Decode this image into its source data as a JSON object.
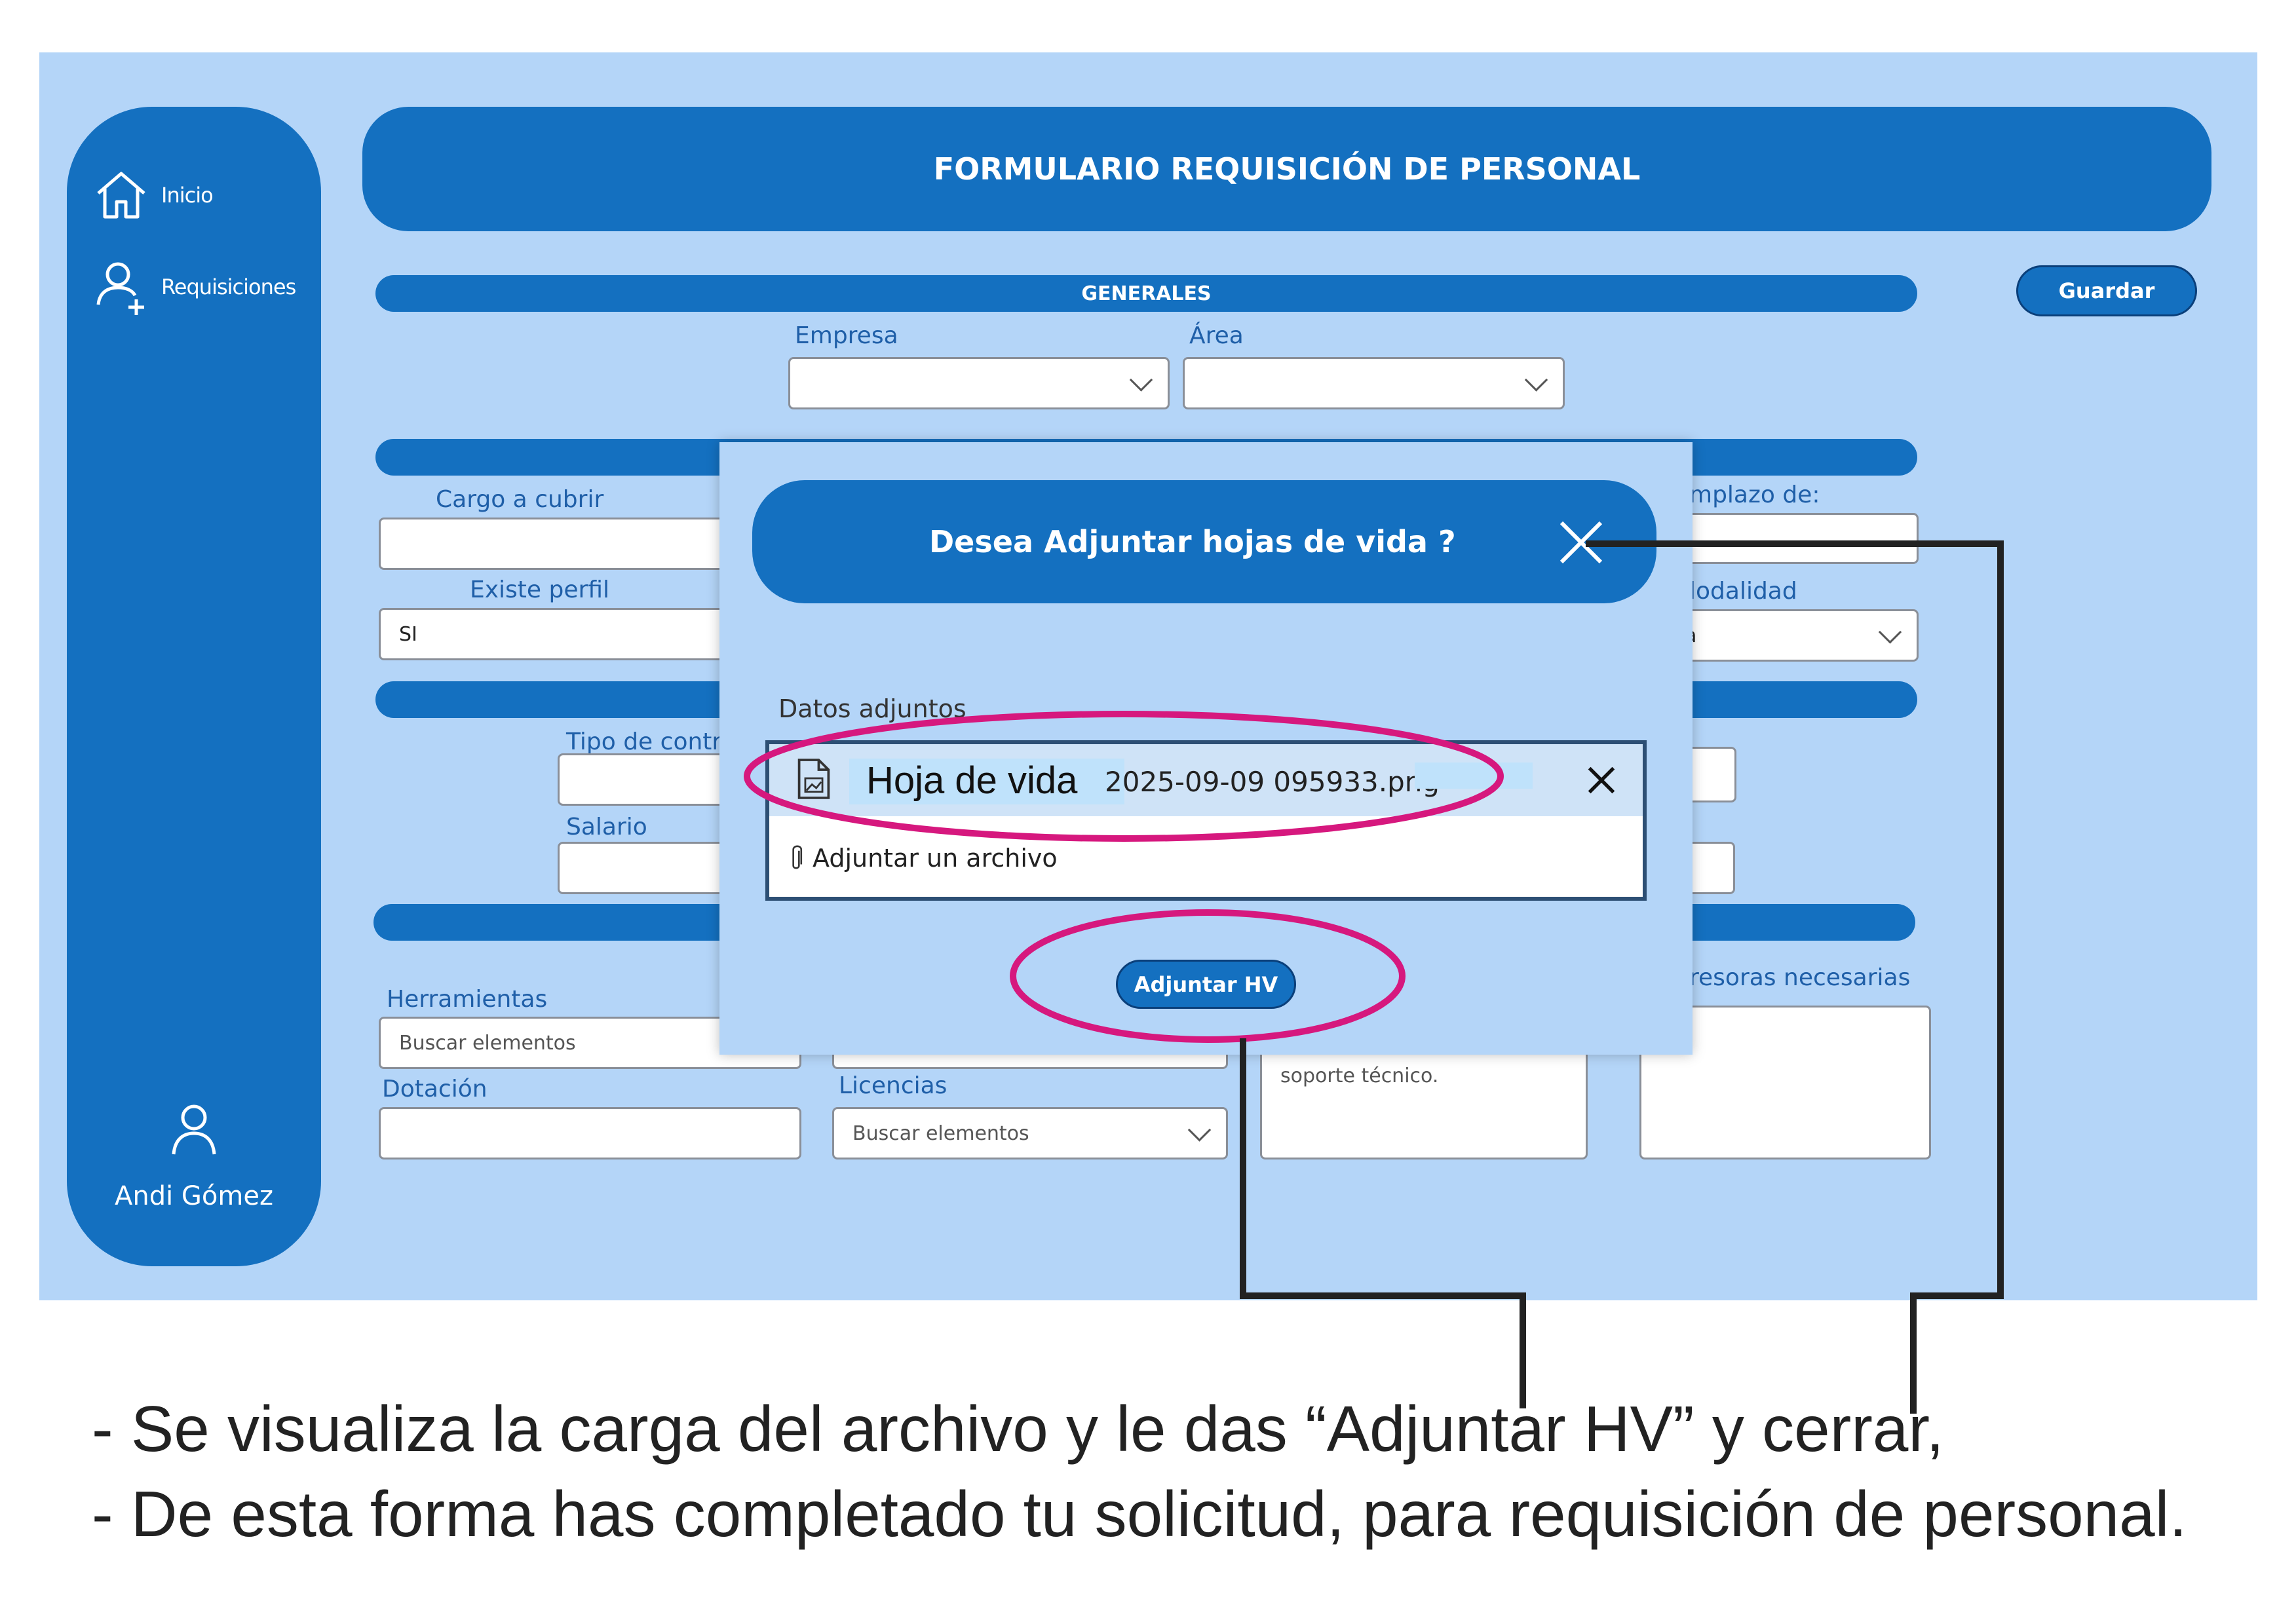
{
  "sidebar": {
    "items": [
      {
        "label": "Inicio",
        "icon": "home-icon"
      },
      {
        "label": "Requisiciones",
        "icon": "add-user-icon"
      }
    ],
    "user_name": "Andi Gómez"
  },
  "header": {
    "title": "FORMULARIO REQUISICIÓN DE PERSONAL"
  },
  "toolbar": {
    "save_label": "Guardar"
  },
  "sections": {
    "generales": "GENERALES"
  },
  "form": {
    "empresa_label": "Empresa",
    "area_label": "Área",
    "cargo_label": "Cargo a cubrir",
    "existe_perfil_label": "Existe perfil",
    "existe_perfil_value": "SI",
    "reemplazo_label": "mplazo de:",
    "modalidad_label": "lodalidad",
    "modalidad_value": "a",
    "tipo_contrato_label": "Tipo de contr",
    "salario_label": "Salario",
    "herramientas_label": "Herramientas",
    "herramientas_placeholder": "Buscar elementos",
    "dotacion_label": "Dotación",
    "licencias_label": "Licencias",
    "licencias_placeholder": "Buscar elementos",
    "soporte_text": "soporte técnico.",
    "impresoras_label": "resoras necesarias"
  },
  "modal": {
    "title": "Desea Adjuntar hojas de vida ?",
    "attachments_label": "Datos adjuntos",
    "file_name_part1": "Hoja de vida",
    "file_name_part2": "2025-09-09 095933.png",
    "add_file_label": "Adjuntar un archivo",
    "attach_button_label": "Adjuntar HV"
  },
  "caption": {
    "line1": "- Se visualiza la carga del archivo y le das “Adjuntar HV” y cerrar,",
    "line2": "- De esta forma has completado tu solicitud, para requisición de personal."
  },
  "colors": {
    "background": "#b4d5f8",
    "primary": "#1470c0",
    "annotation": "#d6187e",
    "connector": "#222222"
  }
}
